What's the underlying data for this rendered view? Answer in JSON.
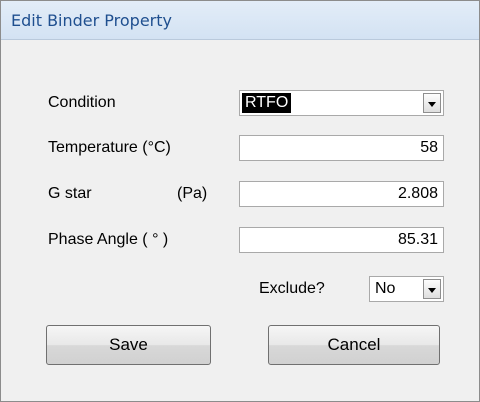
{
  "window": {
    "title": "Edit Binder Property"
  },
  "form": {
    "condition_label": "Condition",
    "condition_value": "RTFO",
    "temperature_label": "Temperature (°C)",
    "temperature_value": "58",
    "gstar_label": "G star",
    "gstar_unit": "(Pa)",
    "gstar_value": "2.808",
    "phase_label": "Phase Angle ( ° )",
    "phase_value": "85.31",
    "exclude_label": "Exclude?",
    "exclude_value": "No"
  },
  "buttons": {
    "save_label": "Save",
    "cancel_label": "Cancel"
  },
  "icons": {
    "dropdown": "chevron-down-icon"
  }
}
